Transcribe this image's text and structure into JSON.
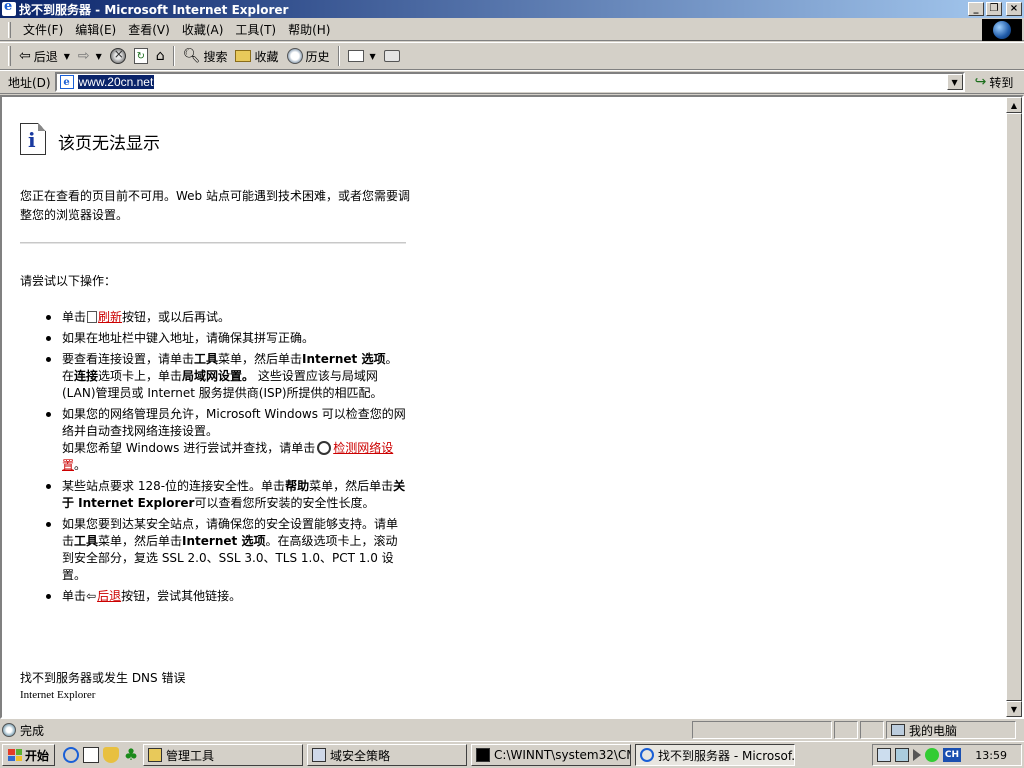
{
  "window": {
    "title": "找不到服务器 - Microsoft Internet Explorer",
    "buttons": [
      "_",
      "❐",
      "×"
    ]
  },
  "menu": [
    "文件(F)",
    "编辑(E)",
    "查看(V)",
    "收藏(A)",
    "工具(T)",
    "帮助(H)"
  ],
  "toolbar": {
    "back": "后退",
    "search": "搜索",
    "favorites": "收藏",
    "history": "历史"
  },
  "address": {
    "label": "地址(D)",
    "url": "www.20cn.net",
    "go": "转到"
  },
  "page": {
    "title": "该页无法显示",
    "intro": "您正在查看的页目前不可用。Web 站点可能遇到技术困难，或者您需要调整您的浏览器设置。",
    "try_heading": "请尝试以下操作：",
    "bullet1_pre": "单击",
    "bullet1_link": "刷新",
    "bullet1_post": "按钮，或以后再试。",
    "bullet2": "如果在地址栏中键入地址，请确保其拼写正确。",
    "bullet3_a": "要查看连接设置，请单击",
    "bullet3_b": "工具",
    "bullet3_c": "菜单，然后单击",
    "bullet3_d": "Internet 选项",
    "bullet3_e": "。在",
    "bullet3_f": "连接",
    "bullet3_g": "选项卡上，单击",
    "bullet3_h": "局域网设置。",
    "bullet3_i": " 这些设置应该与局域网(LAN)管理员或 Internet 服务提供商(ISP)所提供的相匹配。",
    "bullet4_a": "如果您的网络管理员允许，Microsoft Windows 可以检查您的网络并自动查找网络连接设置。",
    "bullet4_b": "如果您希望 Windows 进行尝试并查找，请单击",
    "bullet4_link": "检测网络设置",
    "bullet4_end": "。",
    "bullet5_a": "某些站点要求 128-位的连接安全性。单击",
    "bullet5_b": "帮助",
    "bullet5_c": "菜单，然后单击",
    "bullet5_d": "关于 Internet Explorer",
    "bullet5_e": "可以查看您所安装的安全性长度。",
    "bullet6_a": "如果您要到达某安全站点，请确保您的安全设置能够支持。请单击",
    "bullet6_b": "工具",
    "bullet6_c": "菜单，然后单击",
    "bullet6_d": "Internet 选项",
    "bullet6_e": "。在高级选项卡上，滚动到安全部分，复选 SSL 2.0、SSL 3.0、TLS 1.0、PCT 1.0 设置。",
    "bullet7_pre": "单击",
    "bullet7_link": "后退",
    "bullet7_post": "按钮，尝试其他链接。",
    "footer_error": "找不到服务器或发生 DNS 错误",
    "footer_app": "Internet Explorer"
  },
  "status": {
    "text": "完成",
    "zone": "我的电脑"
  },
  "taskbar": {
    "start": "开始",
    "tasks": [
      "管理工具",
      "域安全策略",
      "C:\\WINNT\\system32\\CM...",
      "找不到服务器 - Microsof..."
    ],
    "lang": "CH",
    "clock": "13:59"
  },
  "colors": {
    "titlebar_start": "#0a246a",
    "titlebar_end": "#a6caf0",
    "link": "#c00000",
    "chrome": "#d4d0c8"
  }
}
